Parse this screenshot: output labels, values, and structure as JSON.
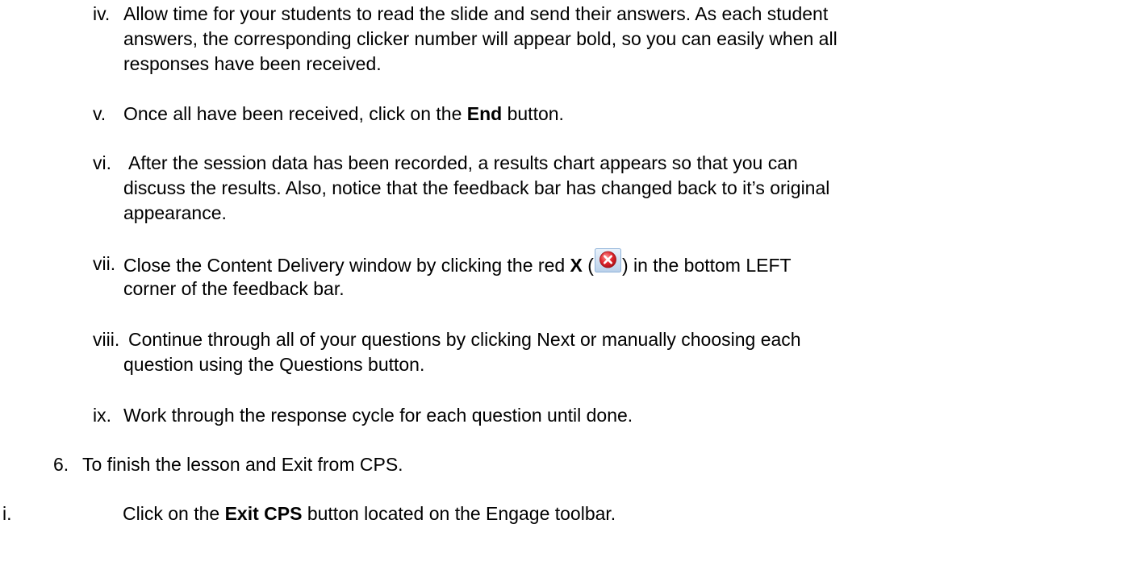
{
  "items": [
    {
      "marker": "iv.",
      "lines": [
        "Allow time for your students to read the slide and send their answers. As each student",
        "answers, the corresponding clicker number will appear bold, so you can easily when all",
        "responses have been received."
      ]
    },
    {
      "marker": "v.",
      "pre": "Once all have been received, click on the",
      "bold": "End",
      "post": "button."
    },
    {
      "marker": "vi.",
      "lines": [
        "After the session data has been recorded, a results chart appears so that you can",
        "discuss the results. Also, notice that the feedback bar has changed back to it’s original",
        "appearance."
      ]
    },
    {
      "marker": "vii.",
      "pre": "Close the Content Delivery window by clicking the red",
      "bold": "X",
      "open_paren": "(",
      "icon": "close-red-x-icon",
      "post": ") in the bottom LEFT",
      "line2": "corner of the feedback bar."
    },
    {
      "marker": "viii.",
      "lines": [
        "Continue through all of your questions by clicking Next or manually choosing each",
        "question using the Questions button."
      ]
    },
    {
      "marker": "ix.",
      "lines": [
        "Work through the response cycle for each question until done."
      ]
    },
    {
      "marker": "6.",
      "lines": [
        "To finish the lesson and Exit from CPS."
      ]
    },
    {
      "marker": "i.",
      "pre": "Click on the",
      "bold": "Exit CPS",
      "post": "button located on the Engage toolbar."
    }
  ],
  "colors": {
    "icon_red": "#e0262e",
    "icon_frame": "#8fb3d9",
    "text": "#000000"
  }
}
